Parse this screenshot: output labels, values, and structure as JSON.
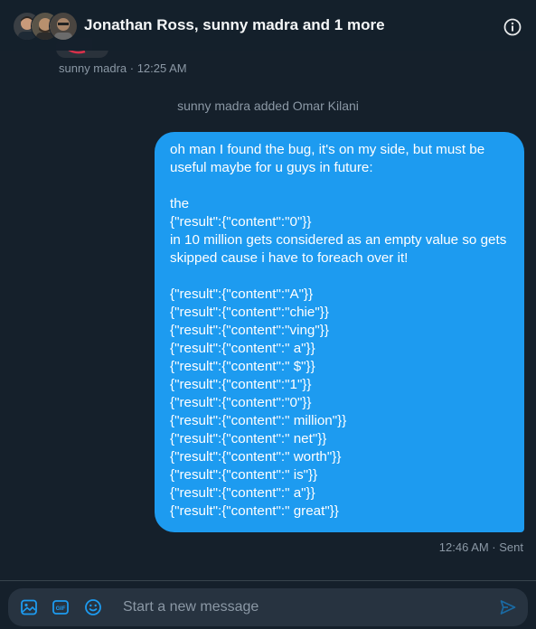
{
  "header": {
    "title": "Jonathan Ross, sunny madra and 1 more",
    "info_icon": "info-icon"
  },
  "previous_message": {
    "meta": "sunny madra · 12:25 AM"
  },
  "system_message": "sunny madra added Omar Kilani",
  "message": {
    "lines": [
      "oh man I found the bug, it's on my side, but must be",
      "useful maybe for u guys in future:",
      "",
      "the",
      "{\"result\":{\"content\":\"0\"}}",
      "in 10 million gets considered as an empty value so gets",
      "skipped cause i have to foreach over it!",
      "",
      "{\"result\":{\"content\":\"A\"}}",
      "{\"result\":{\"content\":\"chie\"}}",
      "{\"result\":{\"content\":\"ving\"}}",
      "{\"result\":{\"content\":\" a\"}}",
      "{\"result\":{\"content\":\" $\"}}",
      "{\"result\":{\"content\":\"1\"}}",
      "{\"result\":{\"content\":\"0\"}}",
      "{\"result\":{\"content\":\" million\"}}",
      "{\"result\":{\"content\":\" net\"}}",
      "{\"result\":{\"content\":\" worth\"}}",
      "{\"result\":{\"content\":\" is\"}}",
      "{\"result\":{\"content\":\" a\"}}",
      "{\"result\":{\"content\":\" great\"}}"
    ],
    "meta": "12:46 AM · Sent"
  },
  "composer": {
    "placeholder": "Start a new message",
    "icons": [
      "image-icon",
      "gif-icon",
      "emoji-icon",
      "send-icon"
    ]
  },
  "colors": {
    "background": "#15202b",
    "bubble": "#1d9bf0",
    "accent": "#1d9bf0",
    "muted_text": "#8b98a5",
    "composer_bg": "#273340"
  }
}
